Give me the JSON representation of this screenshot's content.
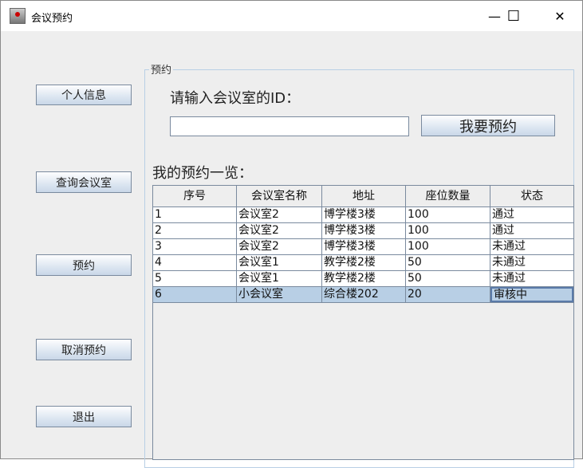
{
  "window": {
    "title": "会议预约",
    "minimize": "—",
    "maximize": "☐",
    "close": "✕"
  },
  "sidebar": {
    "items": [
      {
        "label": "个人信息"
      },
      {
        "label": "查询会议室"
      },
      {
        "label": "预约"
      },
      {
        "label": "取消预约"
      },
      {
        "label": "退出"
      }
    ]
  },
  "panel": {
    "title": "预约",
    "id_prompt": "请输入会议室的ID：",
    "id_value": "",
    "reserve_button": "我要预约",
    "list_label": "我的预约一览："
  },
  "table": {
    "columns": [
      "序号",
      "会议室名称",
      "地址",
      "座位数量",
      "状态"
    ],
    "rows": [
      [
        "1",
        "会议室2",
        "博学楼3楼",
        "100",
        "通过"
      ],
      [
        "2",
        "会议室2",
        "博学楼3楼",
        "100",
        "通过"
      ],
      [
        "3",
        "会议室2",
        "博学楼3楼",
        "100",
        "未通过"
      ],
      [
        "4",
        "会议室1",
        "教学楼2楼",
        "50",
        "未通过"
      ],
      [
        "5",
        "会议室1",
        "教学楼2楼",
        "50",
        "未通过"
      ],
      [
        "6",
        "小会议室",
        "综合楼202",
        "20",
        "审核中"
      ]
    ],
    "selected_row": 6
  }
}
